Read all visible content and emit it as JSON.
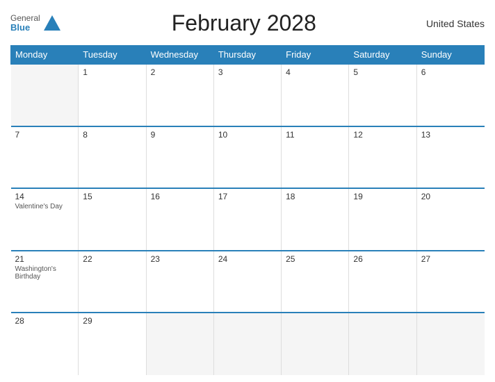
{
  "header": {
    "title": "February 2028",
    "country": "United States",
    "logo": {
      "general": "General",
      "blue": "Blue"
    }
  },
  "weekdays": [
    "Monday",
    "Tuesday",
    "Wednesday",
    "Thursday",
    "Friday",
    "Saturday",
    "Sunday"
  ],
  "weeks": [
    [
      {
        "day": "",
        "holiday": "",
        "empty": true
      },
      {
        "day": "1",
        "holiday": ""
      },
      {
        "day": "2",
        "holiday": ""
      },
      {
        "day": "3",
        "holiday": ""
      },
      {
        "day": "4",
        "holiday": ""
      },
      {
        "day": "5",
        "holiday": ""
      },
      {
        "day": "6",
        "holiday": ""
      }
    ],
    [
      {
        "day": "7",
        "holiday": ""
      },
      {
        "day": "8",
        "holiday": ""
      },
      {
        "day": "9",
        "holiday": ""
      },
      {
        "day": "10",
        "holiday": ""
      },
      {
        "day": "11",
        "holiday": ""
      },
      {
        "day": "12",
        "holiday": ""
      },
      {
        "day": "13",
        "holiday": ""
      }
    ],
    [
      {
        "day": "14",
        "holiday": "Valentine's Day"
      },
      {
        "day": "15",
        "holiday": ""
      },
      {
        "day": "16",
        "holiday": ""
      },
      {
        "day": "17",
        "holiday": ""
      },
      {
        "day": "18",
        "holiday": ""
      },
      {
        "day": "19",
        "holiday": ""
      },
      {
        "day": "20",
        "holiday": ""
      }
    ],
    [
      {
        "day": "21",
        "holiday": "Washington's Birthday"
      },
      {
        "day": "22",
        "holiday": ""
      },
      {
        "day": "23",
        "holiday": ""
      },
      {
        "day": "24",
        "holiday": ""
      },
      {
        "day": "25",
        "holiday": ""
      },
      {
        "day": "26",
        "holiday": ""
      },
      {
        "day": "27",
        "holiday": ""
      }
    ],
    [
      {
        "day": "28",
        "holiday": ""
      },
      {
        "day": "29",
        "holiday": ""
      },
      {
        "day": "",
        "holiday": "",
        "empty": true
      },
      {
        "day": "",
        "holiday": "",
        "empty": true
      },
      {
        "day": "",
        "holiday": "",
        "empty": true
      },
      {
        "day": "",
        "holiday": "",
        "empty": true
      },
      {
        "day": "",
        "holiday": "",
        "empty": true
      }
    ]
  ]
}
